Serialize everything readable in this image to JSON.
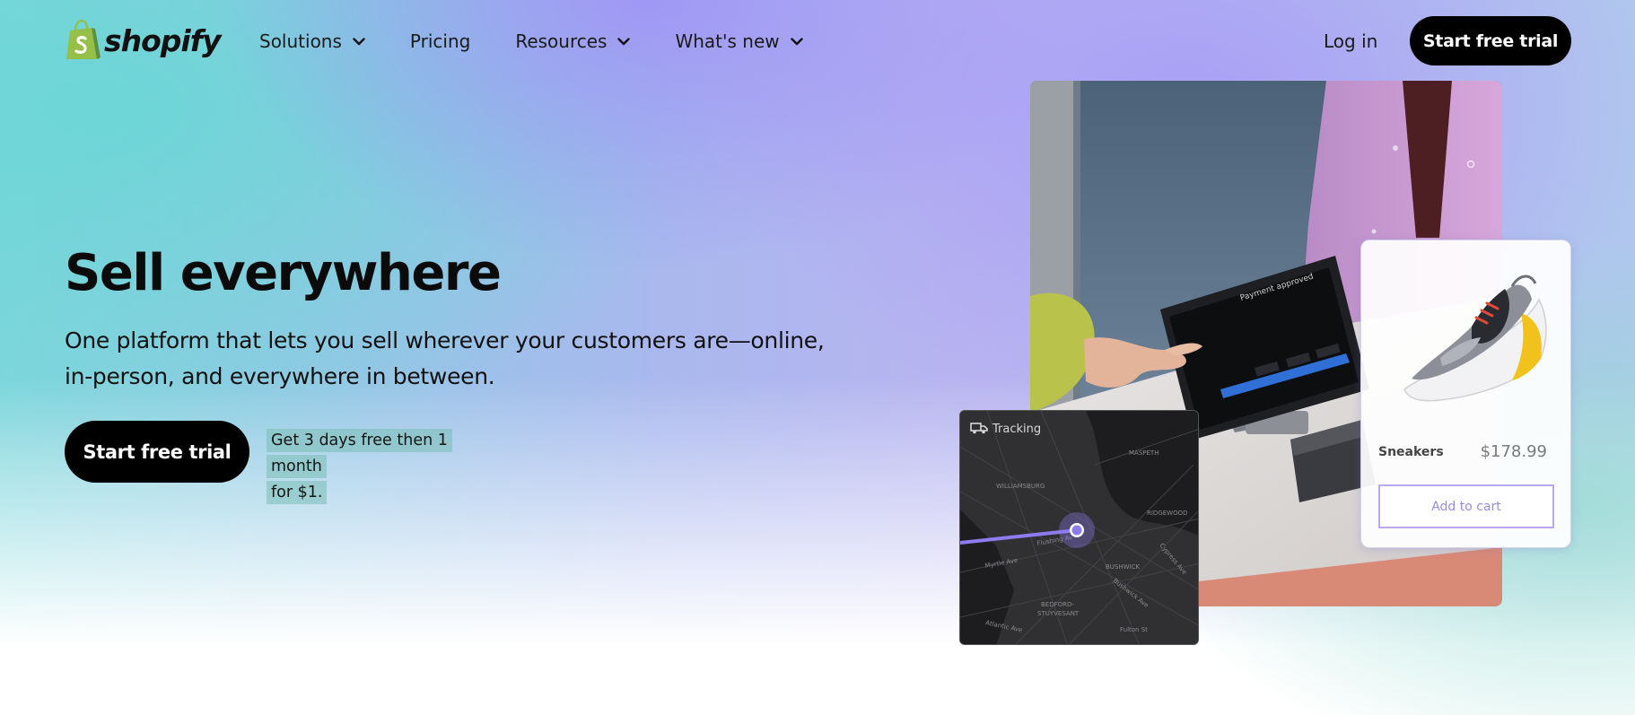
{
  "brand": {
    "name": "shopify"
  },
  "nav": {
    "links": [
      {
        "label": "Solutions",
        "has_dropdown": true
      },
      {
        "label": "Pricing",
        "has_dropdown": false
      },
      {
        "label": "Resources",
        "has_dropdown": true
      },
      {
        "label": "What's new",
        "has_dropdown": true
      }
    ],
    "login": "Log in",
    "cta": "Start free trial"
  },
  "hero": {
    "title": "Sell everywhere",
    "subtitle": "One platform that lets you sell wherever your customers are—online, in-person, and everywhere in between.",
    "cta": "Start free trial",
    "offer_line1": "Get 3 days free then 1 month",
    "offer_line2": "for $1."
  },
  "pos_screen": {
    "text": "Payment approved"
  },
  "product_card": {
    "name": "Sneakers",
    "price": "$178.99",
    "button": "Add to cart"
  },
  "tracking": {
    "label": "Tracking",
    "map_labels": [
      "WILLIAMSBURG",
      "MASPETH",
      "RIDGEWOOD",
      "BUSHWICK",
      "BEDFORD-",
      "STUYVESANT",
      "Flushing Av",
      "Myrtle Ave",
      "Cypress Ave",
      "Bushwick Ave",
      "Atlantic Ave",
      "Fulton St"
    ]
  },
  "colors": {
    "brand_green": "#95bf47",
    "cta_black": "#000000",
    "accent_purple": "#8f7bf0",
    "offer_highlight": "#86c7bd"
  },
  "icons": [
    "shopify-bag-icon",
    "chevron-down-icon",
    "truck-icon",
    "location-pin-icon"
  ]
}
